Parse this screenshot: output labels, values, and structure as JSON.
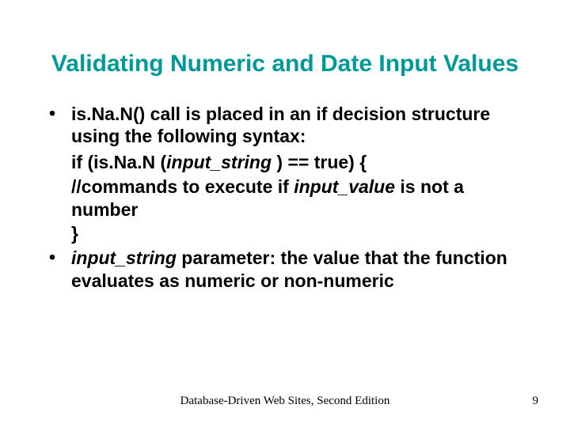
{
  "title": "Validating Numeric and Date Input Values",
  "bullets": {
    "b1": "is.Na.N() call is placed in an if decision structure using the following syntax:",
    "code": {
      "l1a": "if (is.Na.N (",
      "l1b": "input_string",
      "l1c": " ) == true) {",
      "l2a": "//commands to execute if  ",
      "l2b": "input_value",
      "l2c": "  is not a number",
      "l3": "}"
    },
    "b2a": "input_string",
    "b2b": " parameter: the value that the function evaluates as numeric or non-numeric"
  },
  "footer": {
    "center": "Database-Driven Web Sites, Second Edition",
    "page": "9"
  }
}
